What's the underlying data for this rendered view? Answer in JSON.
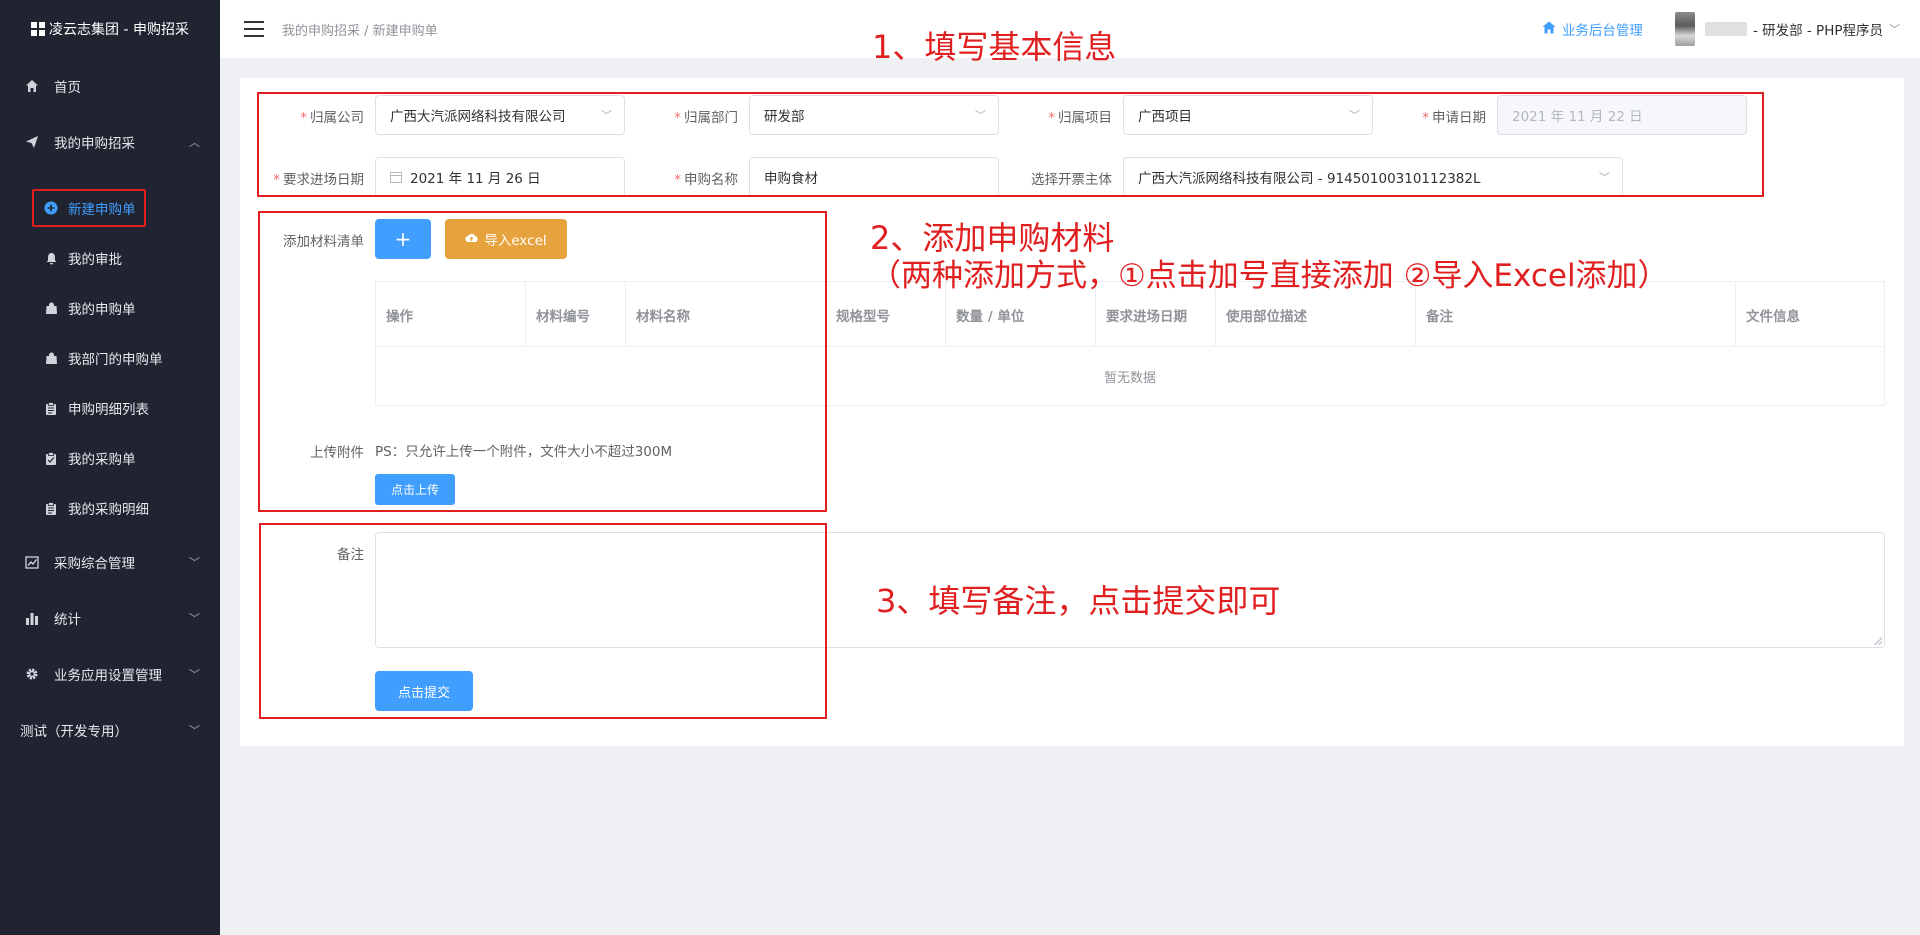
{
  "app": {
    "title": "凌云志集团 - 申购招采"
  },
  "sidebar": {
    "items": [
      {
        "label": "首页",
        "icon": "home-icon"
      },
      {
        "label": "我的申购招采",
        "icon": "send-icon",
        "expanded": true
      },
      {
        "label": "采购综合管理",
        "icon": "chart-icon"
      },
      {
        "label": "统计",
        "icon": "bar-chart-icon"
      },
      {
        "label": "业务应用设置管理",
        "icon": "gear-icon"
      },
      {
        "label": "测试（开发专用）",
        "icon": ""
      }
    ],
    "subitems": [
      {
        "label": "新建申购单",
        "icon": "plus-circle-icon",
        "active": true
      },
      {
        "label": "我的审批",
        "icon": "bell-icon"
      },
      {
        "label": "我的申购单",
        "icon": "bag-icon"
      },
      {
        "label": "我部门的申购单",
        "icon": "bag-icon"
      },
      {
        "label": "申购明细列表",
        "icon": "clipboard-icon"
      },
      {
        "label": "我的采购单",
        "icon": "clipboard-check-icon"
      },
      {
        "label": "我的采购明细",
        "icon": "clipboard-icon"
      }
    ]
  },
  "header": {
    "breadcrumb": "我的申购招采 / 新建申购单",
    "admin_link": "业务后台管理",
    "user_info": "- 研发部 - PHP程序员"
  },
  "form": {
    "company": {
      "label": "归属公司",
      "value": "广西大汽派网络科技有限公司"
    },
    "department": {
      "label": "归属部门",
      "value": "研发部"
    },
    "project": {
      "label": "归属项目",
      "value": "广西项目"
    },
    "apply_date": {
      "label": "申请日期",
      "value": "2021 年 11 月 22 日"
    },
    "entry_date": {
      "label": "要求进场日期",
      "value": "2021 年 11 月 26 日"
    },
    "purchase_name": {
      "label": "申购名称",
      "value": "申购食材"
    },
    "invoice_entity": {
      "label": "选择开票主体",
      "value": "广西大汽派网络科技有限公司 - 91450100310112382L"
    },
    "materials_label": "添加材料清单",
    "add_button": "+",
    "import_button": "导入excel",
    "attachment_label": "上传附件",
    "attachment_hint": "PS：只允许上传一个附件，文件大小不超过300M",
    "upload_button": "点击上传",
    "remark_label": "备注",
    "submit_button": "点击提交"
  },
  "table": {
    "columns": [
      "操作",
      "材料编号",
      "材料名称",
      "规格型号",
      "数量 / 单位",
      "要求进场日期",
      "使用部位描述",
      "备注",
      "文件信息"
    ],
    "empty_text": "暂无数据"
  },
  "annotations": {
    "step1": "1、填写基本信息",
    "step2": "2、添加申购材料",
    "step2_detail": "（两种添加方式，①点击加号直接添加 ②导入Excel添加）",
    "step3": "3、填写备注，点击提交即可"
  },
  "colors": {
    "sidebar_bg": "#1f2430",
    "primary": "#409eff",
    "warning": "#e6a23c",
    "annotation": "#e02020",
    "required": "#f56c6c"
  }
}
